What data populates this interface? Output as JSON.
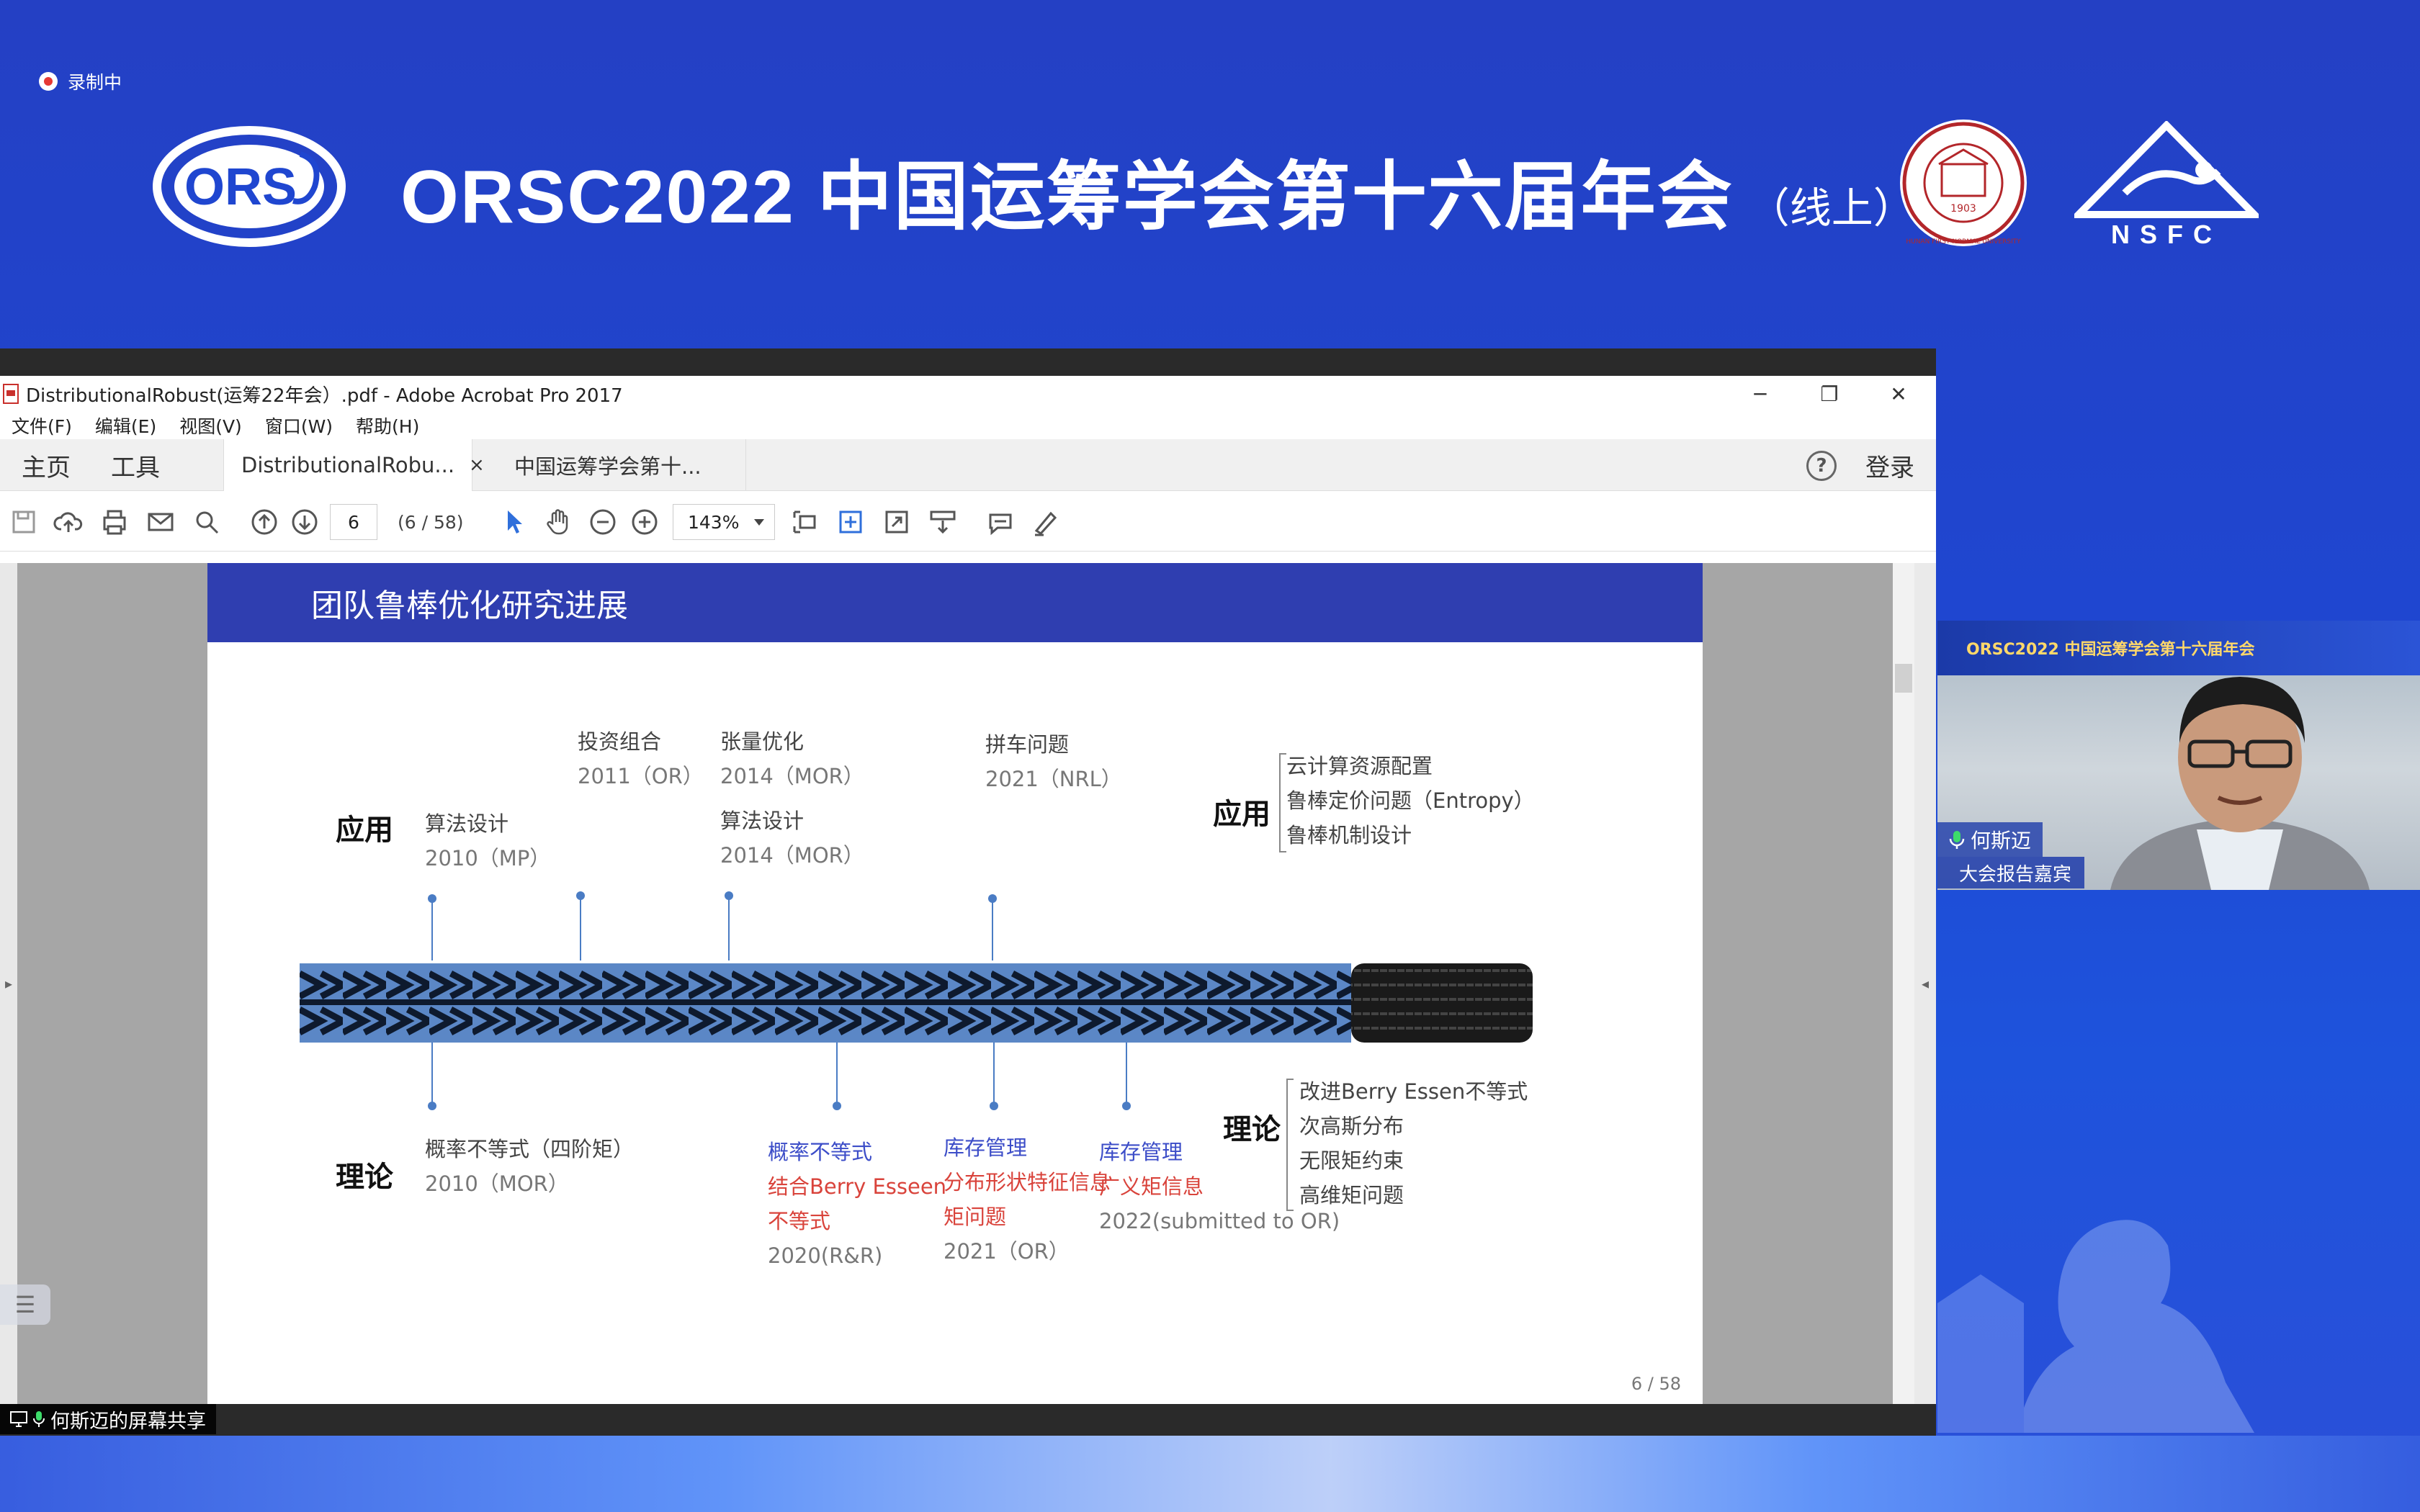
{
  "recording": {
    "label": "录制中"
  },
  "banner": {
    "title": "ORSC2022 中国运筹学会第十六届年会",
    "subtitle": "（线上）",
    "ors_logo_text": "ORS",
    "uni_seal_text": "HUNAN FIRST NORMAL UNIVERSITY",
    "uni_seal_year": "1903",
    "nsfc_logo_text": "NSFC"
  },
  "acrobat": {
    "window_title": "DistributionalRobust(运筹22年会）.pdf - Adobe Acrobat Pro 2017",
    "menu": [
      "文件(F)",
      "编辑(E)",
      "视图(V)",
      "窗口(W)",
      "帮助(H)"
    ],
    "nav_tabs": {
      "home": "主页",
      "tools": "工具"
    },
    "doc_tabs": [
      {
        "label": "DistributionalRobu...",
        "close": "×"
      },
      {
        "label": "中国运筹学会第十..."
      }
    ],
    "login": "登录",
    "help": "?",
    "page_input": "6",
    "page_count": "(6 / 58)",
    "zoom": "143%",
    "colors": {
      "accent": "#2f6fdb"
    }
  },
  "slide": {
    "header": "团队鲁棒优化研究进展",
    "app_label": "应用",
    "theory_label": "理论",
    "top_items": [
      {
        "title": "算法设计",
        "year": "2010（MP）"
      },
      {
        "title": "投资组合",
        "year": "2011（OR）"
      },
      {
        "title": "张量优化",
        "year": "2014（MOR）"
      },
      {
        "title": "算法设计",
        "year": "2014（MOR）"
      },
      {
        "title": "拼车问题",
        "year": "2021（NRL）"
      }
    ],
    "app_right": [
      "云计算资源配置",
      "鲁棒定价问题（Entropy）",
      "鲁棒机制设计"
    ],
    "bottom_items": [
      {
        "lines": [
          "概率不等式（四阶矩）",
          "2010（MOR）"
        ]
      },
      {
        "lines": [
          "概率不等式",
          "结合Berry Esseen",
          "不等式",
          "2020(R&R)"
        ]
      },
      {
        "lines": [
          "库存管理",
          "分布形状特征信息",
          "矩问题",
          "2021（OR）"
        ]
      },
      {
        "lines": [
          "库存管理",
          "广义矩信息",
          "2022(submitted to OR)"
        ]
      }
    ],
    "theory_right": [
      "改进Berry Essen不等式",
      "次高斯分布",
      "无限矩约束",
      "高维矩问题"
    ],
    "page_number": "6 / 58",
    "colors": {
      "header_bg": "#2f3eb0",
      "blue_text": "#3c4dc8",
      "red_text": "#d9433b",
      "pin": "#4a7cc4"
    }
  },
  "webcam": {
    "banner_text": "ORSC2022 中国运筹学会第十六届年会",
    "name": "何斯迈",
    "role": "大会报告嘉宾"
  },
  "share": {
    "label": "何斯迈的屏幕共享"
  }
}
